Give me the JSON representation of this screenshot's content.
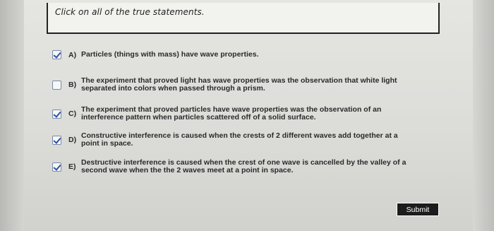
{
  "prompt": "Click on all of the true statements.",
  "options": [
    {
      "letter": "A)",
      "checked": true,
      "lines": [
        "Particles (things with mass) have wave properties."
      ]
    },
    {
      "letter": "B)",
      "checked": false,
      "lines": [
        "The experiment that proved light has wave properties was the observation that white light",
        "separated into colors when passed through a prism."
      ]
    },
    {
      "letter": "C)",
      "checked": true,
      "lines": [
        "The experiment that proved particles have wave properties was the observation of an",
        "interference pattern when particles scattered off of a solid surface."
      ]
    },
    {
      "letter": "D)",
      "checked": true,
      "lines": [
        "Constructive interference is caused when the crests of 2 different waves add together at a",
        "point in space."
      ]
    },
    {
      "letter": "E)",
      "checked": true,
      "lines": [
        "Destructive interference is caused when the crest of one wave is cancelled by the valley of a",
        "second wave when the the 2 waves meet at a point in space."
      ]
    }
  ],
  "submit_label": "Submit"
}
